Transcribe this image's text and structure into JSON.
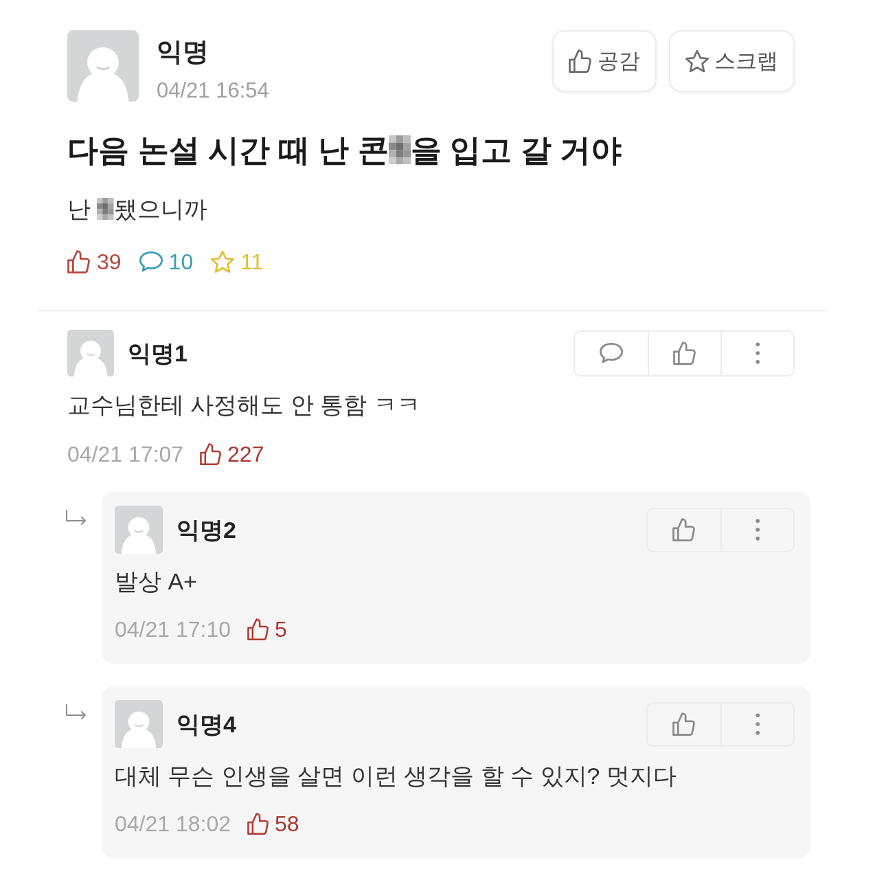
{
  "post": {
    "author": "익명",
    "time": "04/21 16:54",
    "buttons": [
      {
        "kind": "like",
        "label": "공감"
      },
      {
        "kind": "scrap",
        "label": "스크랩"
      }
    ],
    "title": [
      {
        "kind": "text",
        "text": "다음 논설 시간 때 난 콘"
      },
      {
        "kind": "censored"
      },
      {
        "kind": "text",
        "text": "을 입고 갈 거야"
      }
    ],
    "body": [
      {
        "kind": "text",
        "text": "난 "
      },
      {
        "kind": "censored"
      },
      {
        "kind": "text",
        "text": "됐으니까"
      }
    ],
    "stats": [
      {
        "kind": "likes",
        "count": "39",
        "color": "#b5473c"
      },
      {
        "kind": "comments",
        "count": "10",
        "color": "#3a9fb2"
      },
      {
        "kind": "scraps",
        "count": "11",
        "color": "#e0bf2a"
      }
    ]
  },
  "comments": [
    {
      "author": "익명1",
      "text": "교수님한테 사정해도 안 통함 ㅋㅋ",
      "time": "04/21 17:07",
      "likes": "227",
      "actions": [
        {
          "kind": "reply"
        },
        {
          "kind": "like"
        },
        {
          "kind": "more"
        }
      ],
      "replies": [
        {
          "author": "익명2",
          "text": "발상 A+",
          "time": "04/21 17:10",
          "likes": "5",
          "actions": [
            {
              "kind": "like"
            },
            {
              "kind": "more"
            }
          ]
        },
        {
          "author": "익명4",
          "text": "대체 무슨 인생을 살면 이런 생각을 할 수 있지? 멋지다",
          "time": "04/21 18:02",
          "likes": "58",
          "actions": [
            {
              "kind": "like"
            },
            {
              "kind": "more"
            }
          ]
        }
      ]
    }
  ]
}
